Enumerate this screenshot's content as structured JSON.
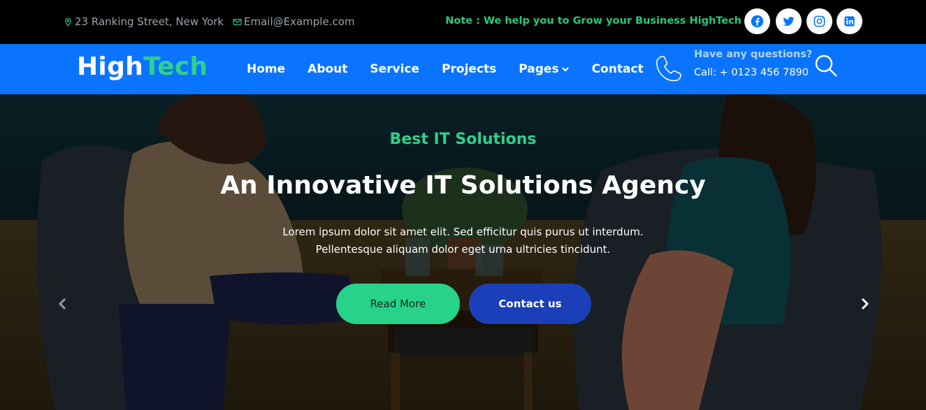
{
  "topbar": {
    "address": "23 Ranking Street, New York",
    "email": "Email@Example.com",
    "note": "Note : We help you to Grow your Business HighTech",
    "social_icons": [
      "facebook-icon",
      "twitter-icon",
      "instagram-icon",
      "linkedin-icon"
    ]
  },
  "navbar": {
    "logo_main": "High",
    "logo_accent": "Tech",
    "links": [
      "Home",
      "About",
      "Service",
      "Projects",
      "Pages",
      "Contact"
    ],
    "questions": "Have any questions?",
    "call": "Call: + 0123 456 7890"
  },
  "hero": {
    "subtitle": "Best IT Solutions",
    "title": "An Innovative IT Solutions Agency",
    "desc_line1": "Lorem ipsum dolor sit amet elit. Sed efficitur quis purus ut interdum.",
    "desc_line2": "Pellentesque aliquam dolor eget urna ultricies tincidunt.",
    "read_more": "Read More",
    "contact_us": "Contact us"
  },
  "colors": {
    "brand_blue": "#0a74ff",
    "accent_green": "#2fd08b",
    "button_blue": "#1b3fb8"
  }
}
